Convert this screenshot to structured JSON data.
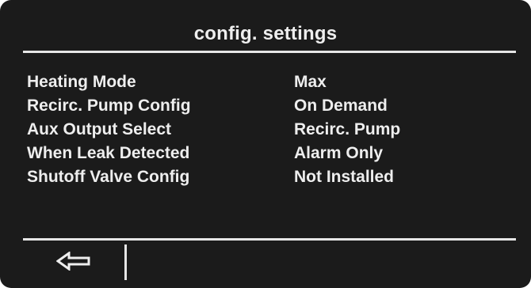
{
  "screen": {
    "title": "config. settings"
  },
  "settings": [
    {
      "label": "Heating Mode",
      "value": "Max"
    },
    {
      "label": "Recirc. Pump Config",
      "value": "On Demand"
    },
    {
      "label": "Aux Output Select",
      "value": "Recirc. Pump"
    },
    {
      "label": "When Leak Detected",
      "value": "Alarm Only"
    },
    {
      "label": "Shutoff Valve Config",
      "value": "Not Installed"
    }
  ],
  "footer": {
    "back_icon": "left-arrow-icon"
  },
  "colors": {
    "background": "#1b1b1b",
    "foreground": "#eeeeee"
  }
}
